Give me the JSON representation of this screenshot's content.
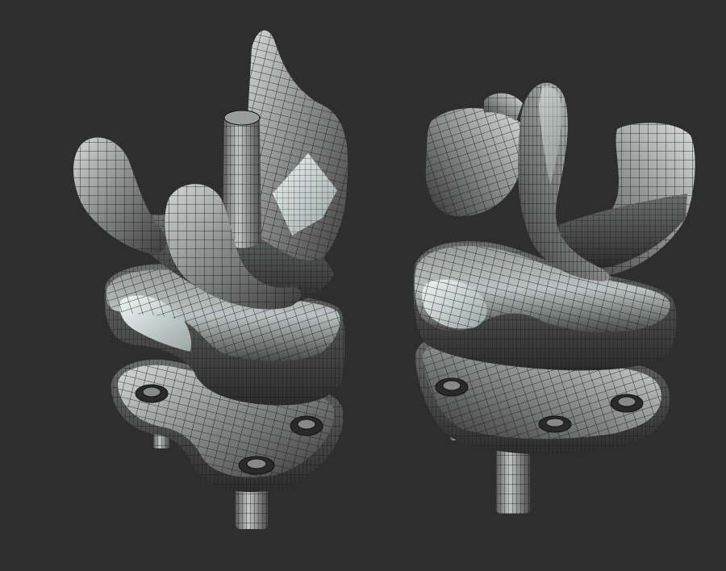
{
  "scene": {
    "background_color": "#2e2e2e",
    "models": [
      {
        "id": "knee-implant-left",
        "view": "oblique",
        "parts": [
          "femoral-component",
          "tibial-insert",
          "tibial-tray"
        ]
      },
      {
        "id": "knee-implant-right",
        "view": "oblique",
        "parts": [
          "femoral-component",
          "tibial-insert",
          "tibial-tray"
        ]
      }
    ],
    "render_style": "wireframe-over-shaded",
    "colors": {
      "surface_dark": "#3a3a3a",
      "surface_mid": "#8c8c8c",
      "surface_light": "#d8e2e0",
      "wire": "#111111"
    }
  }
}
